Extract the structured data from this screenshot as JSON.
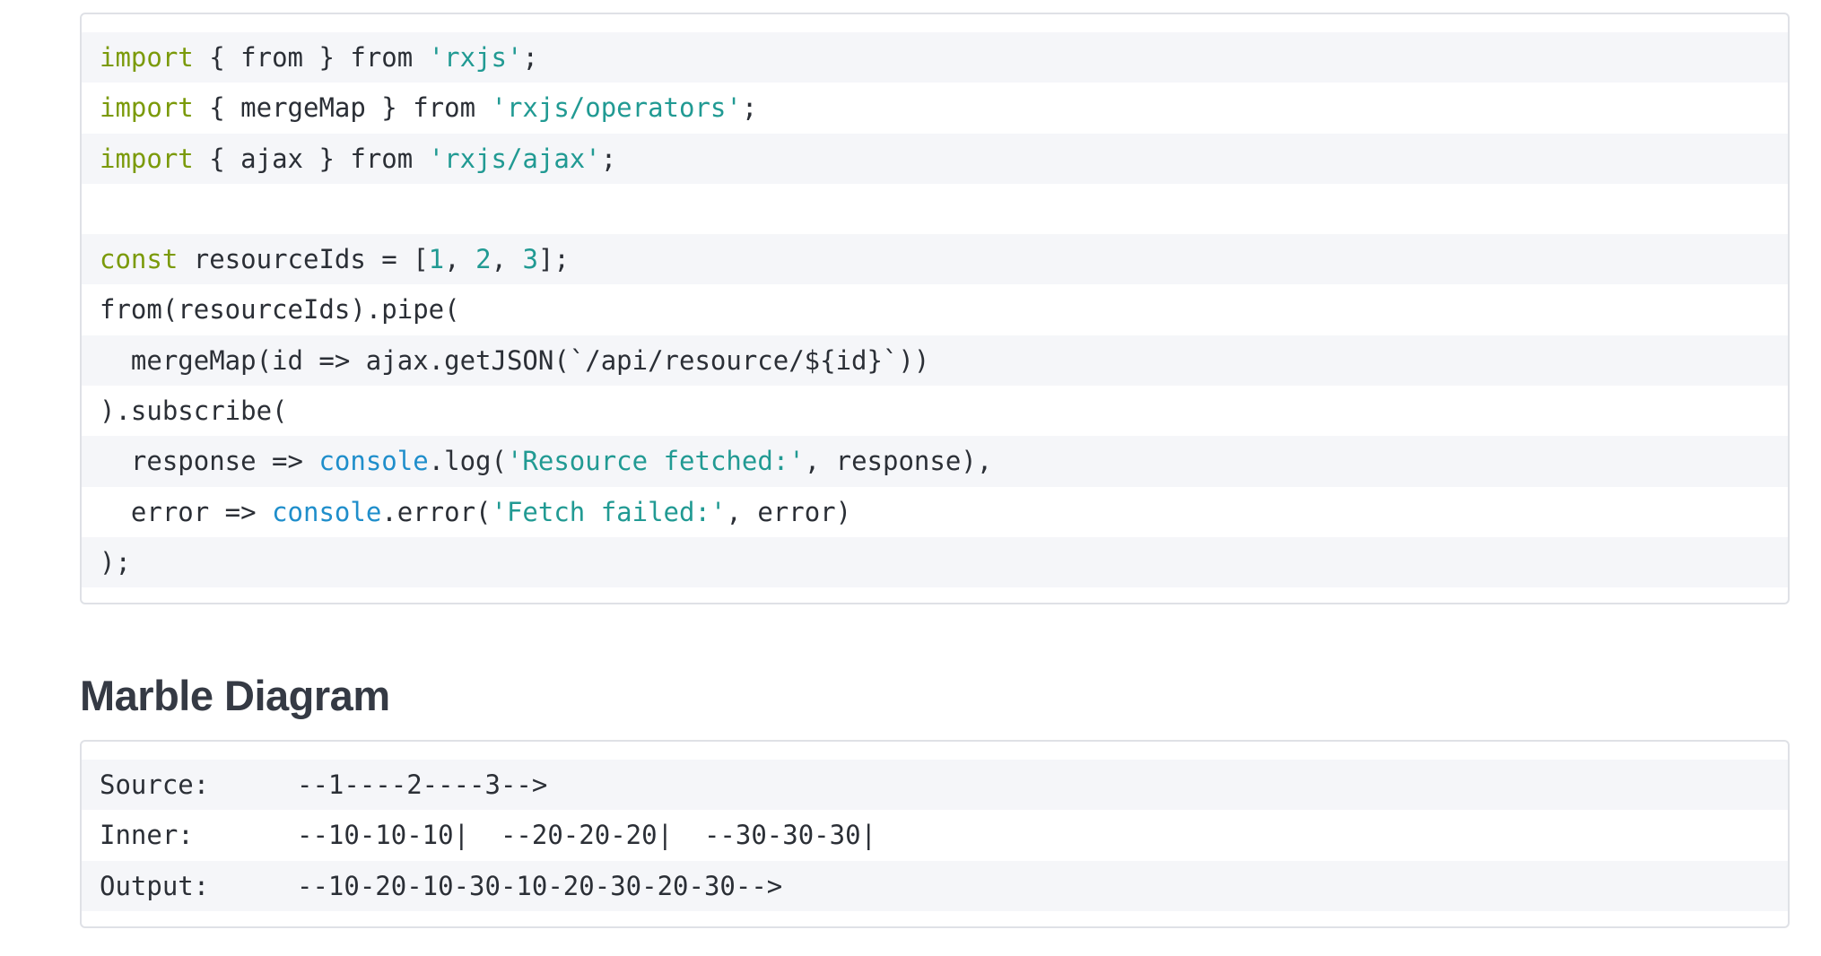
{
  "code": {
    "lines": [
      [
        {
          "t": "import",
          "c": "kw"
        },
        {
          "t": " { from } from "
        },
        {
          "t": "'rxjs'",
          "c": "str"
        },
        {
          "t": ";"
        }
      ],
      [
        {
          "t": "import",
          "c": "kw"
        },
        {
          "t": " { mergeMap } from "
        },
        {
          "t": "'rxjs/operators'",
          "c": "str"
        },
        {
          "t": ";"
        }
      ],
      [
        {
          "t": "import",
          "c": "kw"
        },
        {
          "t": " { ajax } from "
        },
        {
          "t": "'rxjs/ajax'",
          "c": "str"
        },
        {
          "t": ";"
        }
      ],
      [],
      [
        {
          "t": "const",
          "c": "kw"
        },
        {
          "t": " resourceIds = ["
        },
        {
          "t": "1",
          "c": "num"
        },
        {
          "t": ", "
        },
        {
          "t": "2",
          "c": "num"
        },
        {
          "t": ", "
        },
        {
          "t": "3",
          "c": "num"
        },
        {
          "t": "];"
        }
      ],
      [
        {
          "t": "from(resourceIds).pipe("
        }
      ],
      [
        {
          "t": "  mergeMap(id => ajax.getJSON(`/api/resource/${id}`))"
        }
      ],
      [
        {
          "t": ").subscribe("
        }
      ],
      [
        {
          "t": "  response => "
        },
        {
          "t": "console",
          "c": "glob"
        },
        {
          "t": ".log("
        },
        {
          "t": "'Resource fetched:'",
          "c": "str"
        },
        {
          "t": ", response),"
        }
      ],
      [
        {
          "t": "  error => "
        },
        {
          "t": "console",
          "c": "glob"
        },
        {
          "t": ".error("
        },
        {
          "t": "'Fetch failed:'",
          "c": "str"
        },
        {
          "t": ", error)"
        }
      ],
      [
        {
          "t": ");"
        }
      ]
    ]
  },
  "section": {
    "title": "Marble Diagram"
  },
  "marble": {
    "rows": [
      {
        "label": "Source:",
        "value": "--1----2----3-->"
      },
      {
        "label": "Inner:",
        "value": "--10-10-10|  --20-20-20|  --30-30-30|"
      },
      {
        "label": "Output:",
        "value": "--10-20-10-30-10-20-30-20-30-->"
      }
    ]
  },
  "colors": {
    "keyword": "#7b9a0a",
    "string": "#219a93",
    "global": "#1f8ecb",
    "text": "#2b2f36",
    "stripe": "#f5f6f9"
  }
}
